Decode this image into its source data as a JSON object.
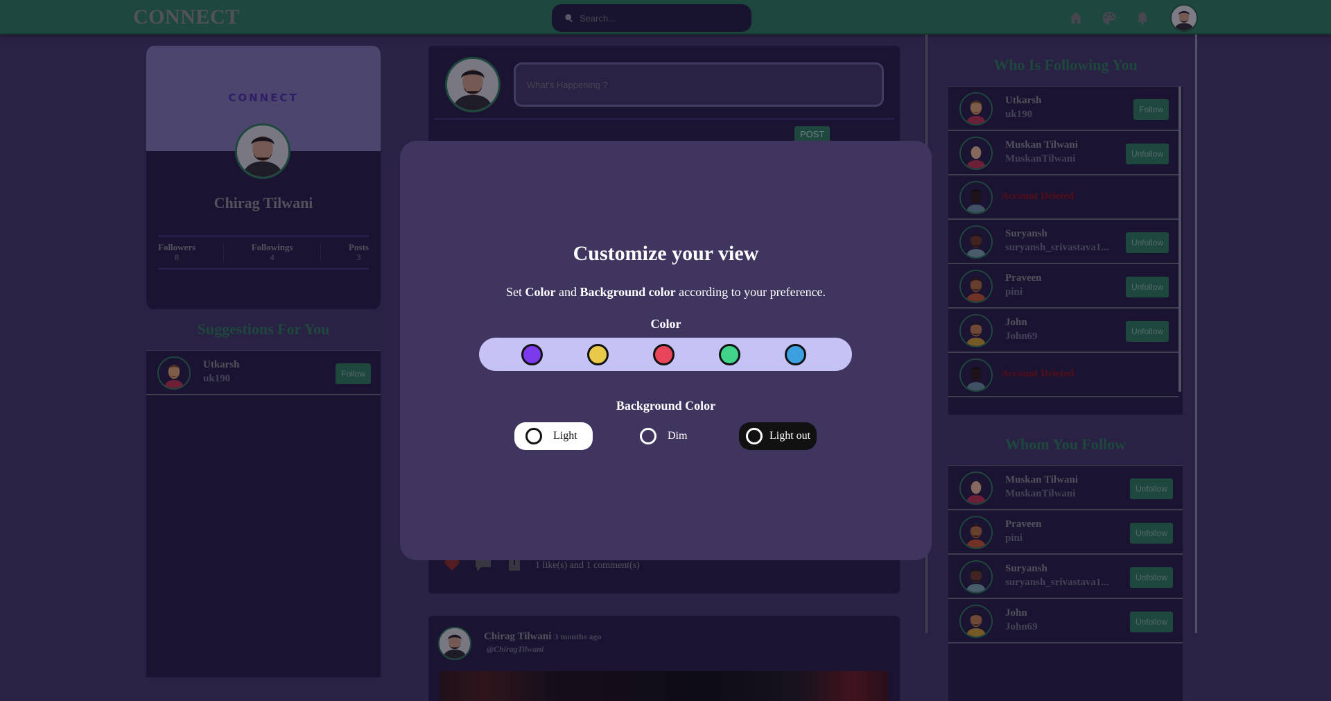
{
  "navbar": {
    "logo": "CONNECT",
    "search_placeholder": "Search...",
    "icons": [
      "home-icon",
      "palette-icon",
      "bell-icon"
    ]
  },
  "profile": {
    "cover_logo": "CONNECT",
    "name": "Chirag Tilwani",
    "stats": [
      {
        "label": "Followers",
        "value": "8"
      },
      {
        "label": "Followings",
        "value": "4"
      },
      {
        "label": "Posts",
        "value": "3"
      }
    ]
  },
  "suggestions": {
    "title": "Suggestions For You",
    "users": [
      {
        "name": "Utkarsh",
        "handle": "uk190",
        "action": "Follow"
      }
    ]
  },
  "compose": {
    "placeholder": "What's Happening ?",
    "post_label": "POST"
  },
  "feed": {
    "post1_stats": "1 like(s) and 1 comment(s)",
    "post2": {
      "author": "Chirag Tilwani",
      "time": "3 months ago",
      "handle": "@ChiragTilwani"
    }
  },
  "followers_panel": {
    "title": "Who Is Following You",
    "users": [
      {
        "name": "Utkarsh",
        "handle": "uk190",
        "action": "Follow"
      },
      {
        "name": "Muskan Tilwani",
        "handle": "MuskanTilwani",
        "action": "Unfollow"
      },
      {
        "deleted": "Account Deleted"
      },
      {
        "name": "Suryansh",
        "handle": "suryansh_srivastava1...",
        "action": "Unfollow"
      },
      {
        "name": "Praveen",
        "handle": "pini",
        "action": "Unfollow"
      },
      {
        "name": "John",
        "handle": "John69",
        "action": "Unfollow"
      },
      {
        "deleted": "Account Deleted"
      }
    ]
  },
  "following_panel": {
    "title": "Whom You Follow",
    "users": [
      {
        "name": "Muskan Tilwani",
        "handle": "MuskanTilwani",
        "action": "Unfollow"
      },
      {
        "name": "Praveen",
        "handle": "pini",
        "action": "Unfollow"
      },
      {
        "name": "Suryansh",
        "handle": "suryansh_srivastava1...",
        "action": "Unfollow"
      },
      {
        "name": "John",
        "handle": "John69",
        "action": "Unfollow"
      }
    ]
  },
  "modal": {
    "title": "Customize your view",
    "subtitle_pre": "Set ",
    "subtitle_color": "Color",
    "subtitle_and": " and ",
    "subtitle_bg": "Background color",
    "subtitle_post": " according to your preference.",
    "color_label": "Color",
    "colors": [
      "#7c3aed",
      "#e8c94a",
      "#e8455a",
      "#3fd48a",
      "#3b9fe0"
    ],
    "bg_label": "Background Color",
    "bg_options": [
      "Light",
      "Dim",
      "Light out"
    ]
  },
  "theme": {
    "accent": "#2b7a52",
    "background": "#3f355f",
    "card": "#241d3f",
    "deleted": "#8b1010"
  }
}
